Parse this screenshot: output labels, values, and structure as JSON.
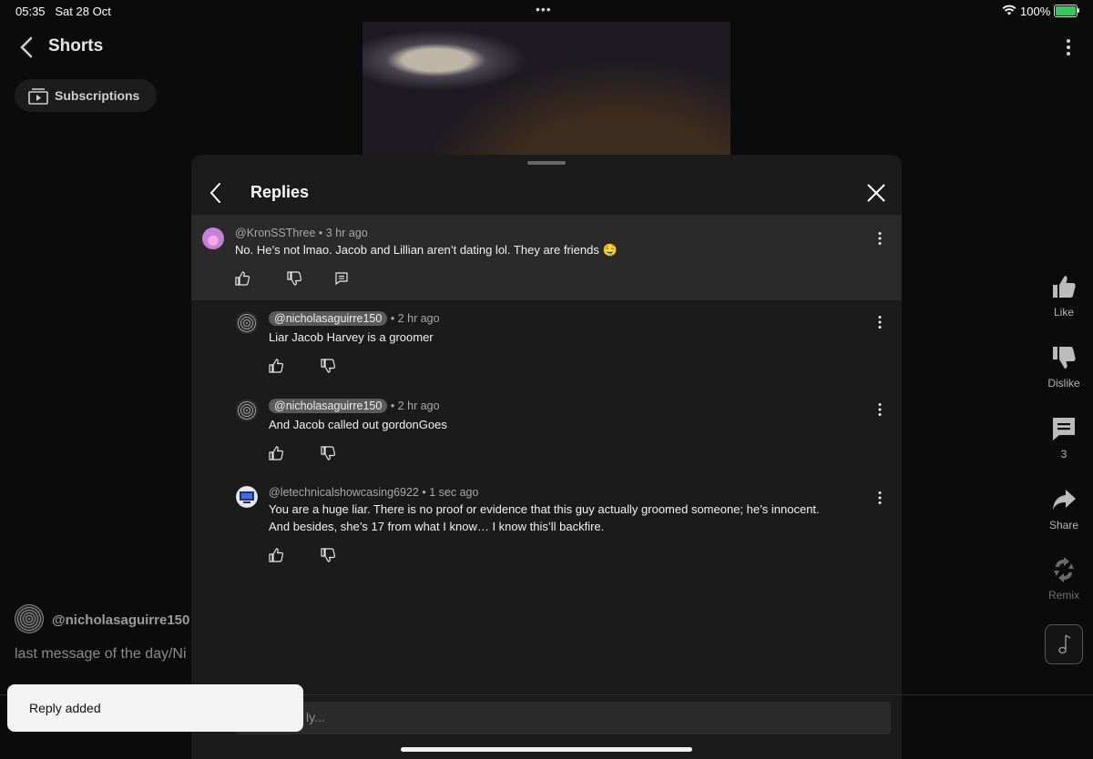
{
  "status_bar": {
    "time": "05:35",
    "date": "Sat 28 Oct",
    "battery": "100%",
    "multitask_dots": "•••"
  },
  "header": {
    "title": "Shorts",
    "back_icon": "chevron-left-icon",
    "more_icon": "more-vertical-icon"
  },
  "subscriptions_chip": {
    "label": "Subscriptions",
    "icon": "subscriptions-icon"
  },
  "video": {
    "channel": "@nicholasaguirre150",
    "caption": "last message of the day/Ni"
  },
  "right_rail": {
    "like": "Like",
    "dislike": "Dislike",
    "comments_count": "3",
    "share": "Share",
    "remix": "Remix"
  },
  "replies_panel": {
    "title": "Replies",
    "parent": {
      "handle": "@KronSSThree",
      "time": "3 hr ago",
      "text": "No. He’s not lmao. Jacob and Lillian aren’t dating lol. They are friends 🤤"
    },
    "replies": [
      {
        "handle": "@nicholasaguirre150",
        "time": "2 hr ago",
        "text": "Liar Jacob Harvey is a groomer"
      },
      {
        "handle": "@nicholasaguirre150",
        "time": "2 hr ago",
        "text": "And Jacob called out gordonGoes"
      },
      {
        "handle": "@letechnicalshowcasing6922",
        "time": "1 sec ago",
        "text_line1": "You are a huge liar. There is no proof or evidence that this guy actually groomed someone; he’s innocent.",
        "text_line2": "And besides, she’s 17 from what I know… I know this’ll backfire."
      }
    ],
    "reply_input_placeholder": "ly..."
  },
  "toast": {
    "text": "Reply added"
  },
  "separator": "•",
  "colors": {
    "background": "#0b0b0b",
    "sheet": "#1b1b1b",
    "highlight": "#2a2a2a",
    "toast": "#f3f3f3"
  }
}
